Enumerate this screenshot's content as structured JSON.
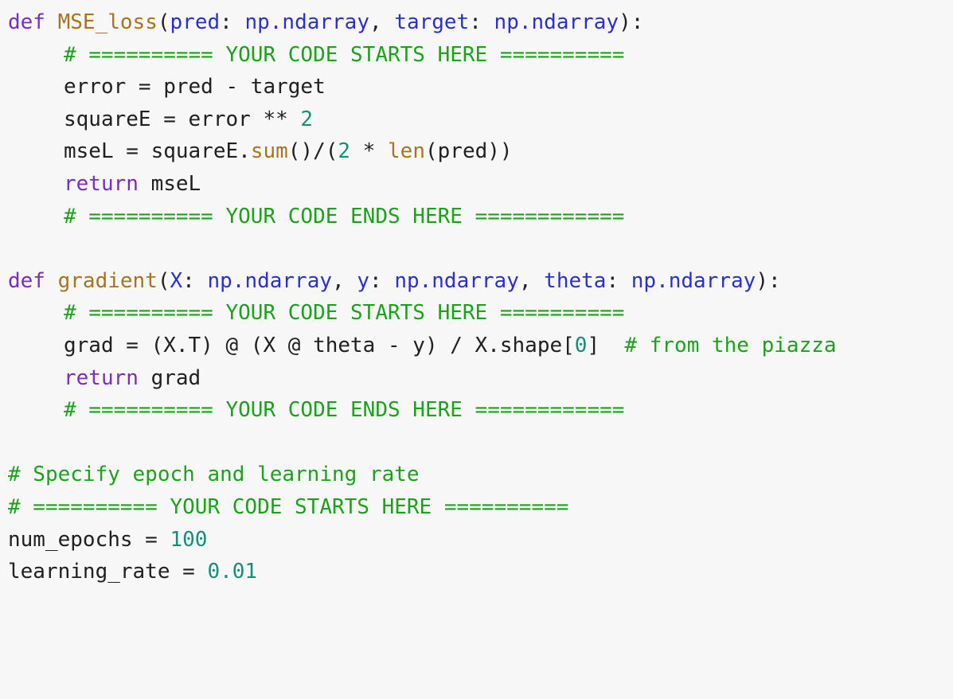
{
  "colors": {
    "background": "#f7f7f7",
    "keyword": "#7b2cc4",
    "function": "#a9741e",
    "parameter": "#2a2fd0",
    "number": "#13907a",
    "comment": "#1aa31a",
    "text": "#202020"
  },
  "code": {
    "l1": {
      "kw": "def",
      "fn": "MSE_loss",
      "p1": "pred",
      "t1": "np.ndarray",
      "p2": "target",
      "t2": "np.ndarray"
    },
    "l2": {
      "cmt": "# ========== YOUR CODE STARTS HERE =========="
    },
    "l3": {
      "text": "error = pred - target"
    },
    "l4": {
      "a": "squareE = error ** ",
      "n": "2"
    },
    "l5": {
      "a": "mseL = squareE.",
      "f1": "sum",
      "b": "()/(",
      "n": "2",
      "c": " * ",
      "f2": "len",
      "d": "(pred))"
    },
    "l6": {
      "kw": "return",
      "text": " mseL"
    },
    "l7": {
      "cmt": "# ========== YOUR CODE ENDS HERE ============"
    },
    "l9": {
      "kw": "def",
      "fn": "gradient",
      "p1": "X",
      "t1": "np.ndarray",
      "p2": "y",
      "t2": "np.ndarray",
      "p3": "theta",
      "t3": "np.ndarray"
    },
    "l10": {
      "cmt": "# ========== YOUR CODE STARTS HERE =========="
    },
    "l11": {
      "a": "grad = (X.T) @ (X @ theta - y) / X.shape[",
      "n": "0",
      "b": "]  ",
      "cmt": "# from the piazza"
    },
    "l12": {
      "kw": "return",
      "text": " grad"
    },
    "l13": {
      "cmt": "# ========== YOUR CODE ENDS HERE ============"
    },
    "l15": {
      "cmt": "# Specify epoch and learning rate"
    },
    "l16": {
      "cmt": "# ========== YOUR CODE STARTS HERE =========="
    },
    "l17": {
      "a": "num_epochs = ",
      "n": "100"
    },
    "l18": {
      "a": "learning_rate = ",
      "n": "0.01"
    }
  }
}
